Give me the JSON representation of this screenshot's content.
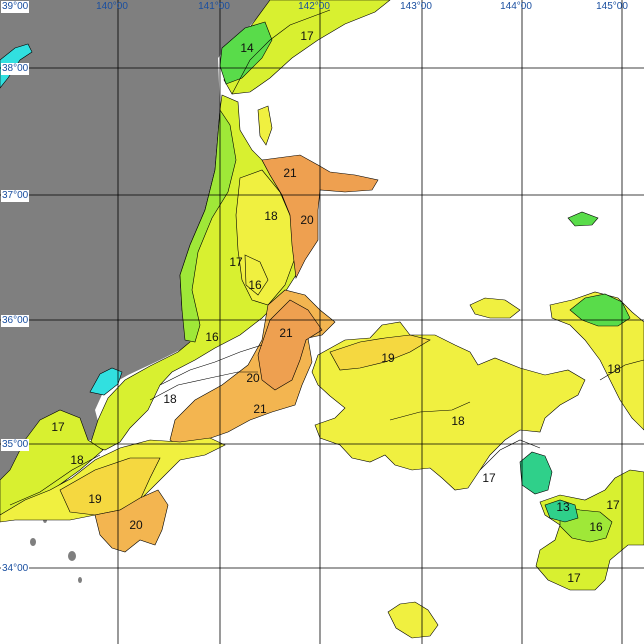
{
  "map": {
    "lon_labels": [
      "140°00",
      "141°00",
      "142°00",
      "143°00",
      "144°00",
      "145°00"
    ],
    "lat_labels": [
      "39°00",
      "38°00",
      "37°00",
      "36°00",
      "35°00",
      "34°00"
    ],
    "isotherms": [
      "14",
      "17",
      "21",
      "18",
      "20",
      "17",
      "16",
      "16",
      "21",
      "19",
      "20",
      "21",
      "18",
      "18",
      "17",
      "18",
      "19",
      "20",
      "18",
      "17",
      "13",
      "16",
      "17",
      "17"
    ],
    "colors": {
      "land": "#7f7f7f",
      "sea_13": "#2fd08a",
      "sea_14": "#59dc4a",
      "sea_16": "#9fe838",
      "sea_17": "#d8f030",
      "sea_18": "#f0f040",
      "sea_19": "#f5d840",
      "sea_20": "#f3b550",
      "sea_21": "#eea050",
      "cold_cyan": "#31e0e0",
      "grid": "#000000"
    }
  }
}
